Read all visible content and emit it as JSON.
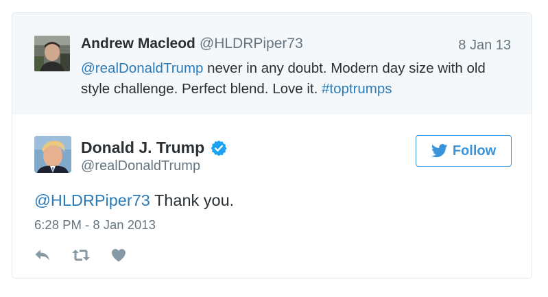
{
  "reply_context": {
    "author_name": "Andrew Macleod",
    "author_handle": "@HLDRPiper73",
    "date": "8 Jan 13",
    "text_mention": "@realDonaldTrump",
    "text_body": " never in any doubt. Modern day size with old style challenge. Perfect blend. Love it. ",
    "text_hashtag": "#toptrumps"
  },
  "tweet": {
    "author_name": "Donald J. Trump",
    "author_handle": "@realDonaldTrump",
    "verified_icon": "verified-badge-icon",
    "follow_label": "Follow",
    "follow_icon": "twitter-bird-icon",
    "text_mention": "@HLDRPiper73",
    "text_body": " Thank you.",
    "timestamp": "6:28 PM - 8 Jan 2013"
  },
  "actions": [
    {
      "icon": "reply-icon"
    },
    {
      "icon": "retweet-icon"
    },
    {
      "icon": "like-heart-icon"
    }
  ],
  "colors": {
    "link": "#2b7bb9",
    "follow_accent": "#3b94d9",
    "verified": "#1da1f2",
    "muted_text": "#66757f",
    "context_bg": "#f5f8fa"
  }
}
